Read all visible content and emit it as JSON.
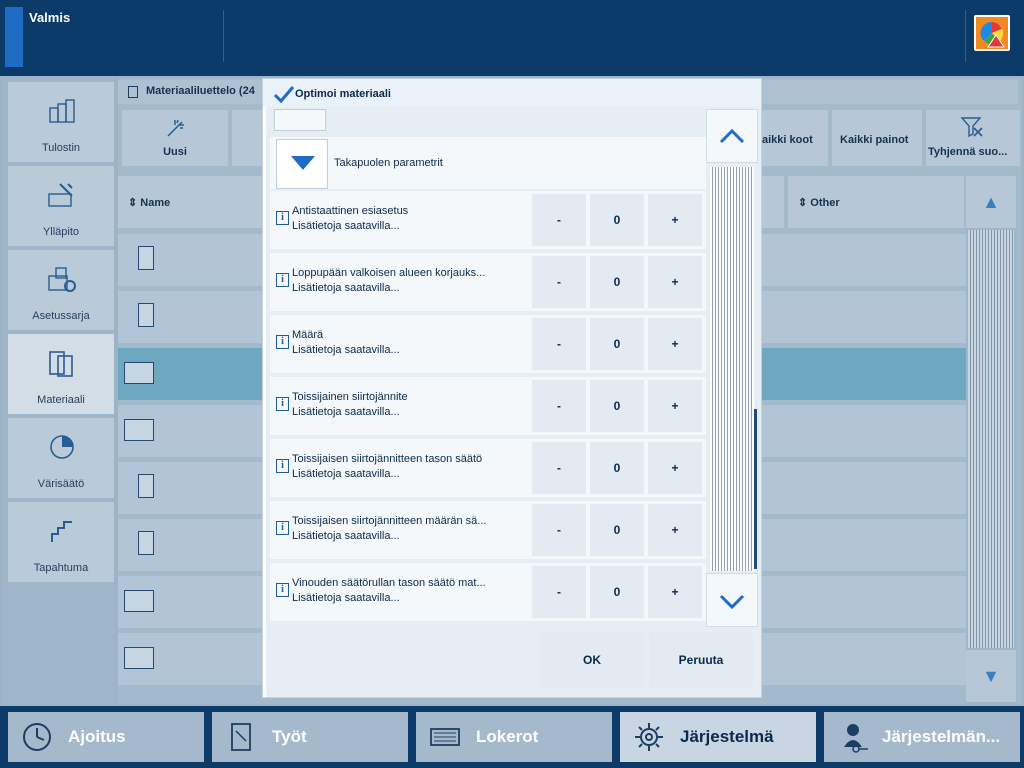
{
  "status": {
    "text": "Valmis"
  },
  "left_nav": {
    "items": [
      {
        "label": "Tulostin",
        "icon": "printer-icon"
      },
      {
        "label": "Ylläpito",
        "icon": "maintenance-icon"
      },
      {
        "label": "Asetussarja",
        "icon": "settings-set-icon"
      },
      {
        "label": "Materiaali",
        "icon": "media-icon",
        "active": true
      },
      {
        "label": "Värisäätö",
        "icon": "color-adjust-icon"
      },
      {
        "label": "Tapahtuma",
        "icon": "event-icon"
      }
    ]
  },
  "media_list": {
    "title": "Materiaaliluettelo (24",
    "toolbar": {
      "new_label": "Uusi",
      "all_sizes_label": "aikki koot",
      "all_weights_label": "Kaikki painot",
      "clear_label": "Tyhjennä suo..."
    },
    "columns": {
      "name": "Name",
      "other": "Other"
    }
  },
  "dialog": {
    "title": "Optimoi materiaali",
    "section_label": "Takapuolen parametrit",
    "info_text": "Lisätietoja saatavilla...",
    "minus_label": "-",
    "plus_label": "+",
    "params": [
      {
        "name": "Antistaattinen esiasetus",
        "value": "0"
      },
      {
        "name": "Loppupään valkoisen alueen korjauks...",
        "value": "0"
      },
      {
        "name": "Määrä",
        "value": "0"
      },
      {
        "name": "Toissijainen siirtojännite",
        "value": "0"
      },
      {
        "name": "Toissijaisen siirtojännitteen tason säätö",
        "value": "0"
      },
      {
        "name": "Toissijaisen siirtojännitteen määrän sä...",
        "value": "0"
      },
      {
        "name": "Vinouden säätörullan tason säätö mat...",
        "value": "0"
      }
    ],
    "ok_label": "OK",
    "cancel_label": "Peruuta"
  },
  "bottom_nav": {
    "tabs": [
      {
        "label": "Ajoitus",
        "icon": "clock-icon"
      },
      {
        "label": "Työt",
        "icon": "jobs-icon"
      },
      {
        "label": "Lokerot",
        "icon": "trays-icon"
      },
      {
        "label": "Järjestelmä",
        "icon": "gear-icon",
        "active": true
      },
      {
        "label": "Järjestelmän...",
        "icon": "user-key-icon"
      }
    ]
  },
  "colors": {
    "accent": "#1f6cc4",
    "topbar": "#0c3b69",
    "selected_row": "#6da8c0"
  }
}
